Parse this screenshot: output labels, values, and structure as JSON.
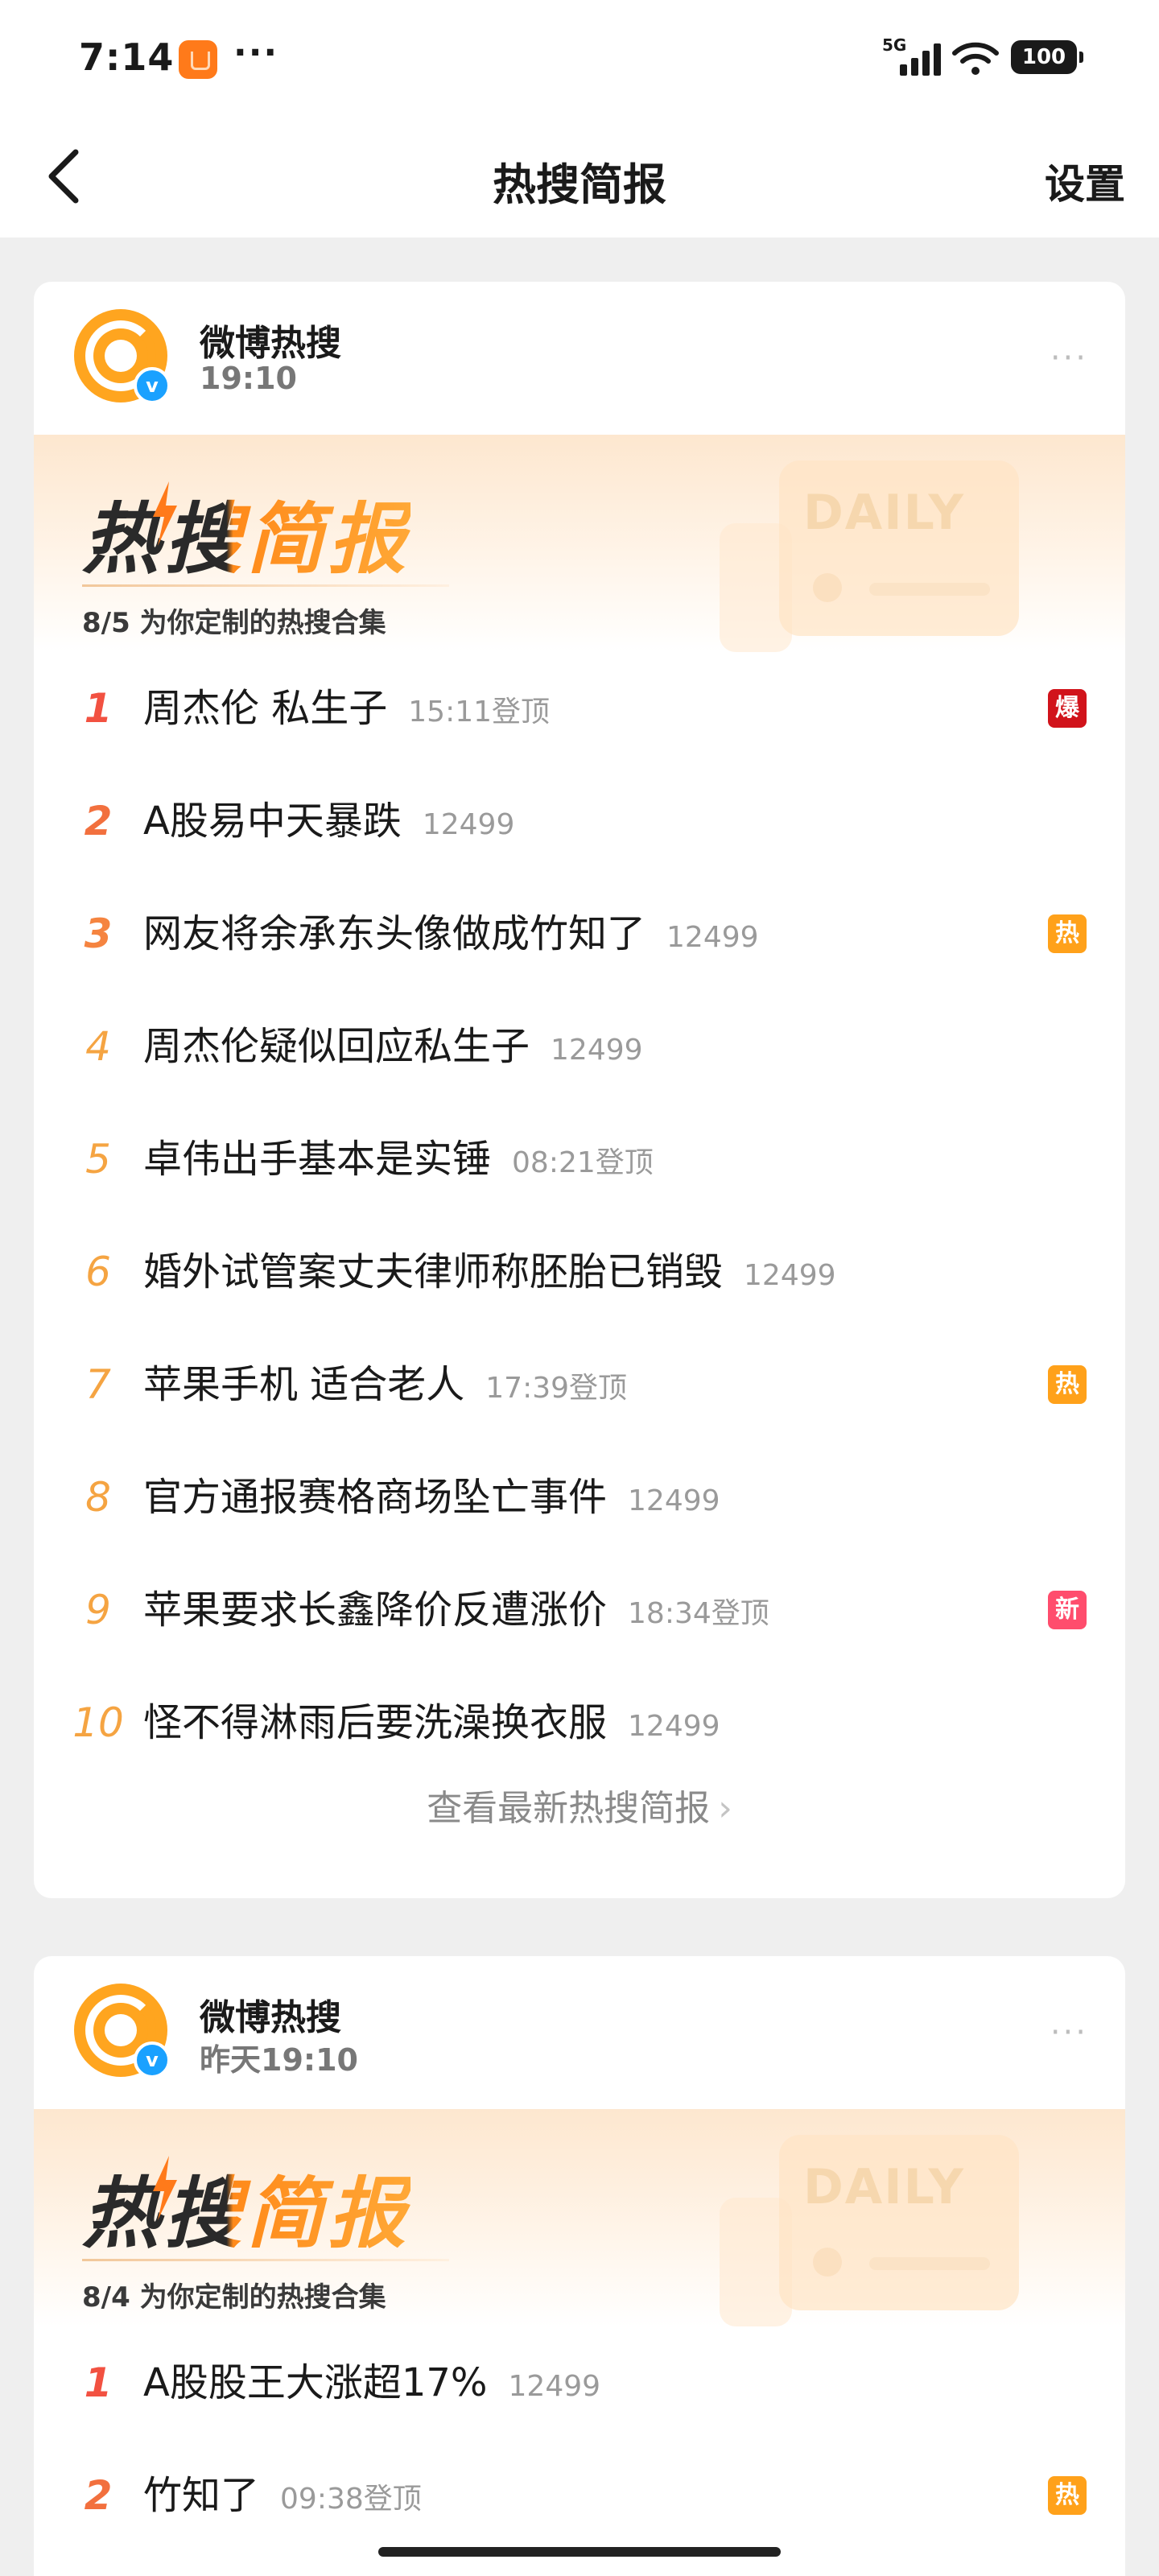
{
  "status_bar": {
    "time": "7:14",
    "more_dots": "···",
    "network": "5G",
    "battery": "100",
    "icons": [
      "notification-app-icon",
      "signal-icon",
      "wifi-icon",
      "battery-icon"
    ]
  },
  "nav": {
    "title": "热搜简报",
    "settings_label": "设置",
    "back_icon": "chevron-left-icon"
  },
  "banner": {
    "title": "热搜简报",
    "daily_text": "DAILY"
  },
  "cards": [
    {
      "author": "微博热搜",
      "time": "19:10",
      "verified": "v",
      "more": "···",
      "subtitle": "8/5 为你定制的热搜合集",
      "items": [
        {
          "rank": "1",
          "title": "周杰伦 私生子",
          "meta": "15:11登顶",
          "tag": "爆"
        },
        {
          "rank": "2",
          "title": "A股易中天暴跌",
          "meta": "12499",
          "tag": ""
        },
        {
          "rank": "3",
          "title": "网友将余承东头像做成竹知了",
          "meta": "12499",
          "tag": "热"
        },
        {
          "rank": "4",
          "title": "周杰伦疑似回应私生子",
          "meta": "12499",
          "tag": ""
        },
        {
          "rank": "5",
          "title": "卓伟出手基本是实锤",
          "meta": "08:21登顶",
          "tag": ""
        },
        {
          "rank": "6",
          "title": "婚外试管案丈夫律师称胚胎已销毁",
          "meta": "12499",
          "tag": ""
        },
        {
          "rank": "7",
          "title": "苹果手机 适合老人",
          "meta": "17:39登顶",
          "tag": "热"
        },
        {
          "rank": "8",
          "title": "官方通报赛格商场坠亡事件",
          "meta": "12499",
          "tag": ""
        },
        {
          "rank": "9",
          "title": "苹果要求长鑫降价反遭涨价",
          "meta": "18:34登顶",
          "tag": "新"
        },
        {
          "rank": "10",
          "title": "怪不得淋雨后要洗澡换衣服",
          "meta": "12499",
          "tag": ""
        }
      ],
      "see_more": "查看最新热搜简报",
      "see_more_chevron": "›"
    },
    {
      "author": "微博热搜",
      "time": "昨天19:10",
      "verified": "v",
      "more": "···",
      "subtitle": "8/4 为你定制的热搜合集",
      "items": [
        {
          "rank": "1",
          "title": "A股股王大涨超17%",
          "meta": "12499",
          "tag": ""
        },
        {
          "rank": "2",
          "title": "竹知了",
          "meta": "09:38登顶",
          "tag": "热"
        }
      ]
    }
  ],
  "colors": {
    "rank1": "#f25141",
    "rank2": "#f2703e",
    "rank3": "#f58440",
    "rank_other": "#f5a442",
    "tag_bao": "#d1131b",
    "tag_re": "#ffa11a",
    "tag_xin": "#ff4d6d",
    "avatar": "#ffa51f",
    "verified": "#1aa1ff"
  }
}
